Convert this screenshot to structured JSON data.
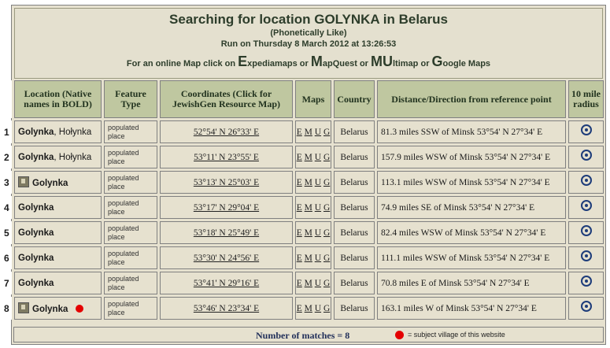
{
  "header": {
    "title": "Searching for location GOLYNKA in Belarus",
    "subtitle": "(Phonetically Like)",
    "run_on": "Run on Thursday 8 March 2012 at 13:26:53",
    "maps_prefix": "For an online Map click on",
    "expedia_initial": "E",
    "expedia_rest": "xpediamaps",
    "or1": "or",
    "mapquest_initial": "M",
    "mapquest_rest": "apQuest",
    "or2": "or",
    "multimap_initial": "MU",
    "multimap_rest": "ltimap",
    "or3": "or",
    "google_initial": "G",
    "google_rest": "oogle Maps"
  },
  "columns": {
    "location": "Location (Native names in BOLD)",
    "feature": "Feature Type",
    "coordinates": "Coordinates (Click for JewishGen Resource Map)",
    "maps": "Maps",
    "country": "Country",
    "distance": "Distance/Direction from reference point",
    "radius": "10 mile radius"
  },
  "rows": [
    {
      "num": "1",
      "name": "Golynka",
      "alt": ", Hołynka",
      "flag": false,
      "subject": false,
      "feature": "populated place",
      "coords": "52°54' N 26°33' E",
      "maps": [
        "E",
        "M",
        "U",
        "G"
      ],
      "country": "Belarus",
      "distance": "81.3 miles SSW of Minsk 53°54' N 27°34' E"
    },
    {
      "num": "2",
      "name": "Golynka",
      "alt": ", Hołynka",
      "flag": false,
      "subject": false,
      "feature": "populated place",
      "coords": "53°11' N 23°55' E",
      "maps": [
        "E",
        "M",
        "U",
        "G"
      ],
      "country": "Belarus",
      "distance": "157.9 miles WSW of Minsk 53°54' N 27°34' E"
    },
    {
      "num": "3",
      "name": "Golynka",
      "alt": "",
      "flag": true,
      "subject": false,
      "feature": "populated place",
      "coords": "53°13' N 25°03' E",
      "maps": [
        "E",
        "M",
        "U",
        "G"
      ],
      "country": "Belarus",
      "distance": "113.1 miles WSW of Minsk 53°54' N 27°34' E"
    },
    {
      "num": "4",
      "name": "Golynka",
      "alt": "",
      "flag": false,
      "subject": false,
      "feature": "populated place",
      "coords": "53°17' N 29°04' E",
      "maps": [
        "E",
        "M",
        "U",
        "G"
      ],
      "country": "Belarus",
      "distance": "74.9 miles SE of Minsk 53°54' N 27°34' E"
    },
    {
      "num": "5",
      "name": "Golynka",
      "alt": "",
      "flag": false,
      "subject": false,
      "feature": "populated place",
      "coords": "53°18' N 25°49' E",
      "maps": [
        "E",
        "M",
        "U",
        "G"
      ],
      "country": "Belarus",
      "distance": "82.4 miles WSW of Minsk 53°54' N 27°34' E"
    },
    {
      "num": "6",
      "name": "Golynka",
      "alt": "",
      "flag": false,
      "subject": false,
      "feature": "populated place",
      "coords": "53°30' N 24°56' E",
      "maps": [
        "E",
        "M",
        "U",
        "G"
      ],
      "country": "Belarus",
      "distance": "111.1 miles WSW of Minsk 53°54' N 27°34' E"
    },
    {
      "num": "7",
      "name": "Golynka",
      "alt": "",
      "flag": false,
      "subject": false,
      "feature": "populated place",
      "coords": "53°41' N 29°16' E",
      "maps": [
        "E",
        "M",
        "U",
        "G"
      ],
      "country": "Belarus",
      "distance": "70.8 miles E of Minsk 53°54' N 27°34' E"
    },
    {
      "num": "8",
      "name": "Golynka",
      "alt": "",
      "flag": true,
      "subject": true,
      "feature": "populated place",
      "coords": "53°46' N 23°34' E",
      "maps": [
        "E",
        "M",
        "U",
        "G"
      ],
      "country": "Belarus",
      "distance": "163.1 miles W of Minsk 53°54' N 27°34' E"
    }
  ],
  "footer": {
    "matches": "Number of matches = 8",
    "legend": "= subject village of this website"
  },
  "colors": {
    "header_bg": "#bfc7a0",
    "cell_bg": "#e6e1cf",
    "subject_dot": "#e40000",
    "radio": "#1d3c7a"
  }
}
